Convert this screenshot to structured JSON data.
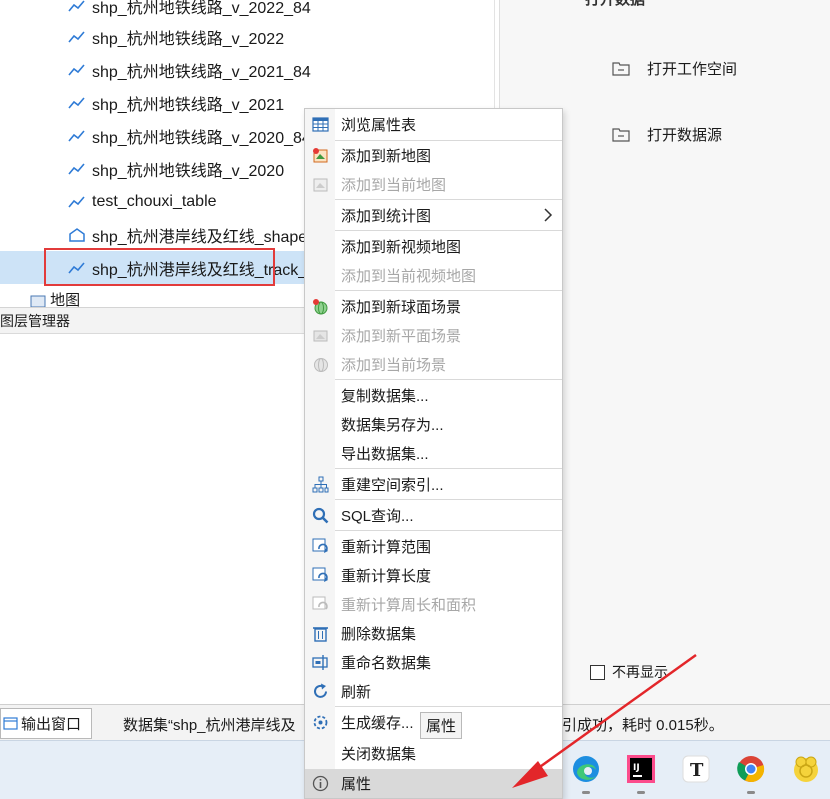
{
  "tree": {
    "items": [
      {
        "label": "shp_杭州地铁线路_v_2022_84",
        "icon": "line-dataset-icon"
      },
      {
        "label": "shp_杭州地铁线路_v_2022",
        "icon": "line-dataset-icon"
      },
      {
        "label": "shp_杭州地铁线路_v_2021_84",
        "icon": "line-dataset-icon"
      },
      {
        "label": "shp_杭州地铁线路_v_2021",
        "icon": "line-dataset-icon"
      },
      {
        "label": "shp_杭州地铁线路_v_2020_84",
        "icon": "line-dataset-icon"
      },
      {
        "label": "shp_杭州地铁线路_v_2020",
        "icon": "line-dataset-icon"
      },
      {
        "label": "test_chouxi_table",
        "icon": "line-dataset-icon"
      },
      {
        "label": "shp_杭州港岸线及红线_shape",
        "icon": "region-dataset-icon"
      },
      {
        "label": "shp_杭州港岸线及红线_track_",
        "icon": "line-dataset-icon",
        "selected": true
      }
    ],
    "maps_node": "地图"
  },
  "layer_manager": {
    "title": "图层管理器"
  },
  "start_panel": {
    "title_fragment": "打开数据",
    "open_workspace": "打开工作空间",
    "open_datasource": "打开数据源",
    "no_show_again": "不再显示"
  },
  "output": {
    "tab_label": "输出窗口",
    "message_left": "数据集“shp_杭州港岸线及",
    "message_right": "引成功，耗时 0.015秒。"
  },
  "tooltip": "属性",
  "context_menu": {
    "items": [
      {
        "label": "浏览属性表",
        "icon": "table-icon",
        "enabled": true
      },
      {
        "label": "添加到新地图",
        "icon": "add-to-new-map-icon",
        "enabled": true
      },
      {
        "label": "添加到当前地图",
        "icon": "add-to-current-map-icon",
        "enabled": false
      },
      {
        "label": "添加到统计图",
        "icon": "",
        "enabled": true,
        "submenu": true
      },
      {
        "label": "添加到新视频地图",
        "icon": "",
        "enabled": true
      },
      {
        "label": "添加到当前视频地图",
        "icon": "",
        "enabled": false
      },
      {
        "label": "添加到新球面场景",
        "icon": "add-to-new-globe-scene-icon",
        "enabled": true
      },
      {
        "label": "添加到新平面场景",
        "icon": "add-to-new-flat-scene-icon",
        "enabled": false
      },
      {
        "label": "添加到当前场景",
        "icon": "add-to-current-scene-icon",
        "enabled": false
      },
      {
        "label": "复制数据集...",
        "icon": "",
        "enabled": true
      },
      {
        "label": "数据集另存为...",
        "icon": "",
        "enabled": true
      },
      {
        "label": "导出数据集...",
        "icon": "",
        "enabled": true
      },
      {
        "label": "重建空间索引...",
        "icon": "spatial-index-icon",
        "enabled": true
      },
      {
        "label": "SQL查询...",
        "icon": "search-icon",
        "enabled": true
      },
      {
        "label": "重新计算范围",
        "icon": "recalculate-icon",
        "enabled": true
      },
      {
        "label": "重新计算长度",
        "icon": "recalculate-icon",
        "enabled": true
      },
      {
        "label": "重新计算周长和面积",
        "icon": "recalculate-icon",
        "enabled": false
      },
      {
        "label": "删除数据集",
        "icon": "trash-icon",
        "enabled": true
      },
      {
        "label": "重命名数据集",
        "icon": "rename-icon",
        "enabled": true
      },
      {
        "label": "刷新",
        "icon": "refresh-icon",
        "enabled": true
      },
      {
        "label": "生成缓存...",
        "icon": "generate-cache-icon",
        "enabled": true
      },
      {
        "label": "关闭数据集",
        "icon": "",
        "enabled": true
      },
      {
        "label": "属性",
        "icon": "info-icon",
        "enabled": true,
        "hovered": true
      }
    ]
  },
  "taskbar": {
    "apps": [
      "edge-browser-icon",
      "intellij-idea-icon",
      "typora-icon",
      "chrome-icon",
      "yellow-app-icon"
    ]
  },
  "colors": {
    "selection": "#cde3f7",
    "highlight_box": "#e23b3b",
    "arrow": "#e3262a",
    "icon_blue": "#2f7bd6",
    "taskbar": "#e6eef7"
  }
}
